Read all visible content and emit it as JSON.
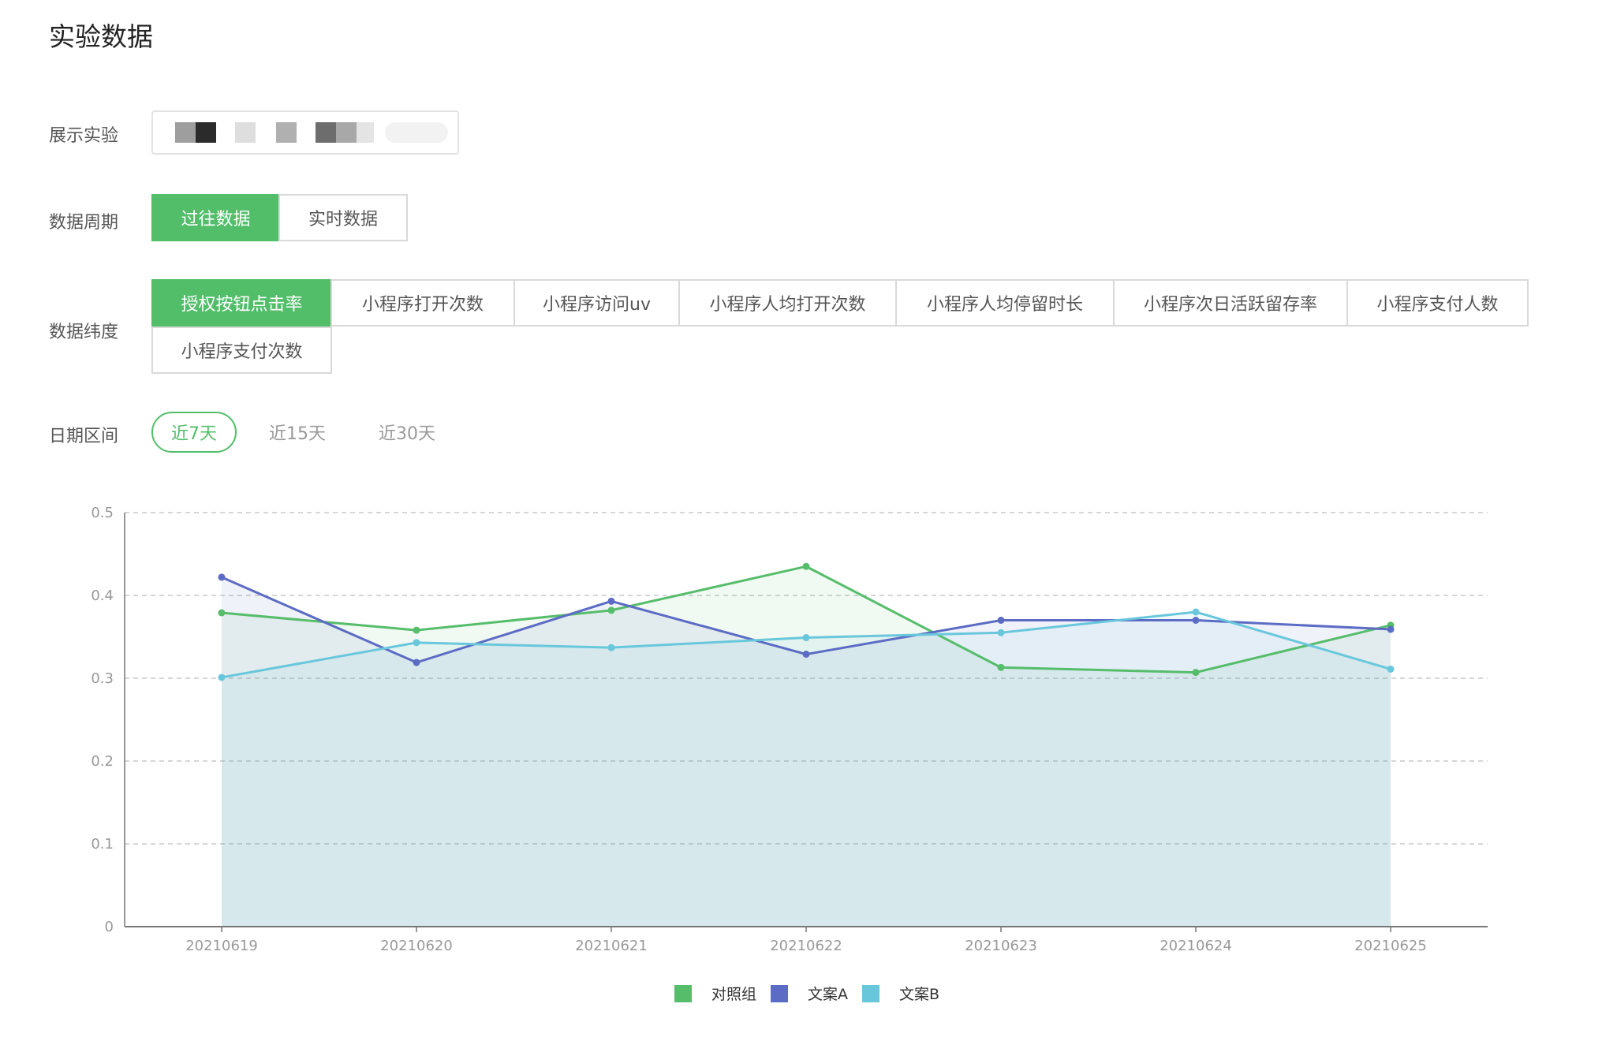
{
  "page": {
    "title": "实验数据"
  },
  "filters": {
    "experiment": {
      "label": "展示实验"
    },
    "period": {
      "label": "数据周期",
      "options": [
        "过往数据",
        "实时数据"
      ],
      "selected": 0
    },
    "dimension": {
      "label": "数据纬度",
      "options": [
        "授权按钮点击率",
        "小程序打开次数",
        "小程序访问uv",
        "小程序人均打开次数",
        "小程序人均停留时长",
        "小程序次日活跃留存率",
        "小程序支付人数",
        "小程序支付次数"
      ],
      "selected": 0
    },
    "date_range": {
      "label": "日期区间",
      "options": [
        "近7天",
        "近15天",
        "近30天"
      ],
      "selected": 0
    }
  },
  "colors": {
    "accent": "#52be6a"
  },
  "chart_data": {
    "type": "area",
    "categories": [
      "20210619",
      "20210620",
      "20210621",
      "20210622",
      "20210623",
      "20210624",
      "20210625"
    ],
    "series": [
      {
        "name": "对照组",
        "color": "#56bd6b",
        "values": [
          0.379,
          0.358,
          0.382,
          0.435,
          0.313,
          0.307,
          0.364
        ]
      },
      {
        "name": "文案A",
        "color": "#5c6cc4",
        "values": [
          0.422,
          0.319,
          0.393,
          0.329,
          0.37,
          0.37,
          0.359
        ]
      },
      {
        "name": "文案B",
        "color": "#69c7dc",
        "values": [
          0.301,
          0.343,
          0.337,
          0.349,
          0.355,
          0.38,
          0.311
        ]
      }
    ],
    "ylim": [
      0,
      0.5
    ],
    "yticks": [
      "0",
      "0.1",
      "0.2",
      "0.3",
      "0.4",
      "0.5"
    ],
    "grid": true,
    "legend": "bottom-center"
  }
}
